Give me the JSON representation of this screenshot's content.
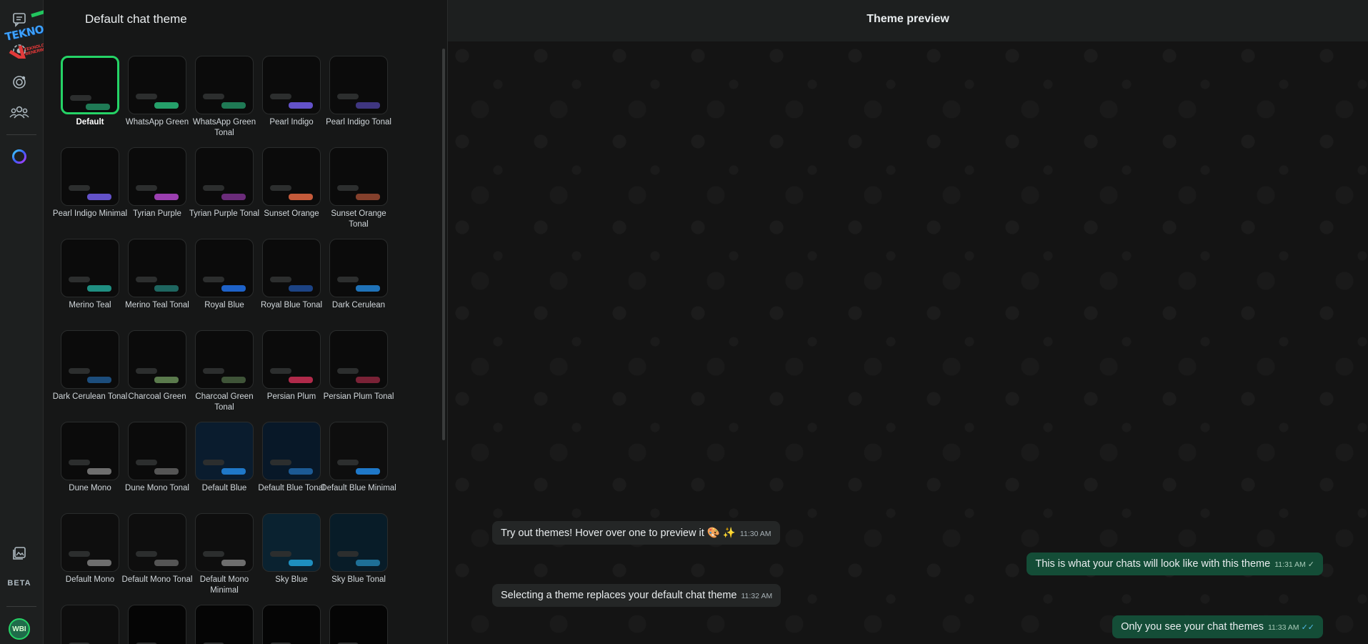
{
  "rail": {
    "icons": [
      "chats-icon",
      "status-icon",
      "channels-icon",
      "communities-icon",
      "meta-ai-icon",
      "media-icon"
    ],
    "beta_label": "BETA",
    "avatar_initials": "WBI"
  },
  "watermark": {
    "logo_text": "TEKNOPEDYA",
    "logo_sub": "TEKNOLOJİYE SIGIR BENERIM!"
  },
  "panel": {
    "title": "Default chat theme",
    "themes": [
      {
        "label": "Default",
        "color": "#1f7a55",
        "selected": true
      },
      {
        "label": "WhatsApp Green",
        "color": "#25a06a"
      },
      {
        "label": "WhatsApp Green Tonal",
        "color": "#1f7a55"
      },
      {
        "label": "Pearl Indigo",
        "color": "#6352c9"
      },
      {
        "label": "Pearl Indigo Tonal",
        "color": "#3f3680"
      },
      {
        "label": "Pearl Indigo Minimal",
        "color": "#6352c9"
      },
      {
        "label": "Tyrian Purple",
        "color": "#9b3fb0"
      },
      {
        "label": "Tyrian Purple Tonal",
        "color": "#6b2c7a"
      },
      {
        "label": "Sunset Orange",
        "color": "#c45a3a"
      },
      {
        "label": "Sunset Orange Tonal",
        "color": "#84402c"
      },
      {
        "label": "Merino Teal",
        "color": "#1f8f82"
      },
      {
        "label": "Merino Teal Tonal",
        "color": "#1e6660"
      },
      {
        "label": "Royal Blue",
        "color": "#1e62c8"
      },
      {
        "label": "Royal Blue Tonal",
        "color": "#1c4384"
      },
      {
        "label": "Dark Cerulean",
        "color": "#1f72b8"
      },
      {
        "label": "Dark Cerulean Tonal",
        "color": "#1c4d7c"
      },
      {
        "label": "Charcoal Green",
        "color": "#5a7a4c"
      },
      {
        "label": "Charcoal Green Tonal",
        "color": "#3f5438"
      },
      {
        "label": "Persian Plum",
        "color": "#b02a4a"
      },
      {
        "label": "Persian Plum Tonal",
        "color": "#7a2236"
      },
      {
        "label": "Dune Mono",
        "color": "#6e6e6e"
      },
      {
        "label": "Dune Mono Tonal",
        "color": "#555555"
      },
      {
        "label": "Default Blue",
        "color": "#1f78c8",
        "bg": "#0a1c2e"
      },
      {
        "label": "Default Blue Tonal",
        "color": "#1c5a94",
        "bg": "#081828"
      },
      {
        "label": "Default Blue Minimal",
        "color": "#1f78c8",
        "bg": "#0e0e0e"
      },
      {
        "label": "Default Mono",
        "color": "#6e6e6e",
        "bg": "#0e0e0e"
      },
      {
        "label": "Default Mono Tonal",
        "color": "#555555",
        "bg": "#0e0e0e"
      },
      {
        "label": "Default Mono Minimal",
        "color": "#6e6e6e",
        "bg": "#0e0e0e"
      },
      {
        "label": "Sky Blue",
        "color": "#1e8fbf",
        "bg": "#0a2230"
      },
      {
        "label": "Sky Blue Tonal",
        "color": "#1e6f96",
        "bg": "#081c28"
      },
      {
        "label": "",
        "color": "#6e6e6e",
        "bg": "#0e0e0e"
      },
      {
        "label": "",
        "color": "#6e6e6e",
        "bg": "#050505"
      },
      {
        "label": "",
        "color": "#6e6e6e",
        "bg": "#050505"
      },
      {
        "label": "",
        "color": "#6e6e6e",
        "bg": "#050505"
      },
      {
        "label": "",
        "color": "#6e6e6e",
        "bg": "#050505"
      }
    ]
  },
  "preview": {
    "title": "Theme preview",
    "messages": [
      {
        "dir": "in",
        "text": "Try out themes! Hover over one to preview it 🎨 ✨",
        "time": "11:30 AM"
      },
      {
        "dir": "out",
        "text": "This is what your chats will look like with this theme",
        "time": "11:31 AM",
        "tick": "✓"
      },
      {
        "dir": "in",
        "text": "Selecting a theme replaces your default chat theme",
        "time": "11:32 AM"
      },
      {
        "dir": "out",
        "text": "Only you see your chat themes",
        "time": "11:33 AM",
        "tick": "✓✓"
      }
    ]
  }
}
